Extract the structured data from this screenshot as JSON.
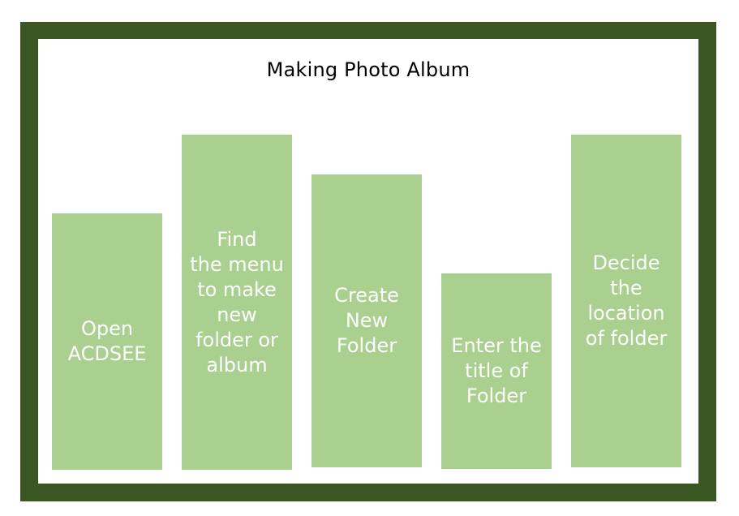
{
  "diagram": {
    "title": "Making Photo Album",
    "steps": [
      {
        "label": "Open\nACDSEE"
      },
      {
        "label": "Find\nthe menu\nto make\nnew\nfolder or\nalbum"
      },
      {
        "label": "Create\nNew\nFolder"
      },
      {
        "label": "Enter the\ntitle of\nFolder"
      },
      {
        "label": "Decide\nthe\nlocation\nof folder"
      }
    ]
  },
  "colors": {
    "frame": "#3a5623",
    "step_fill": "#a9d08e",
    "step_text": "#ffffff"
  }
}
